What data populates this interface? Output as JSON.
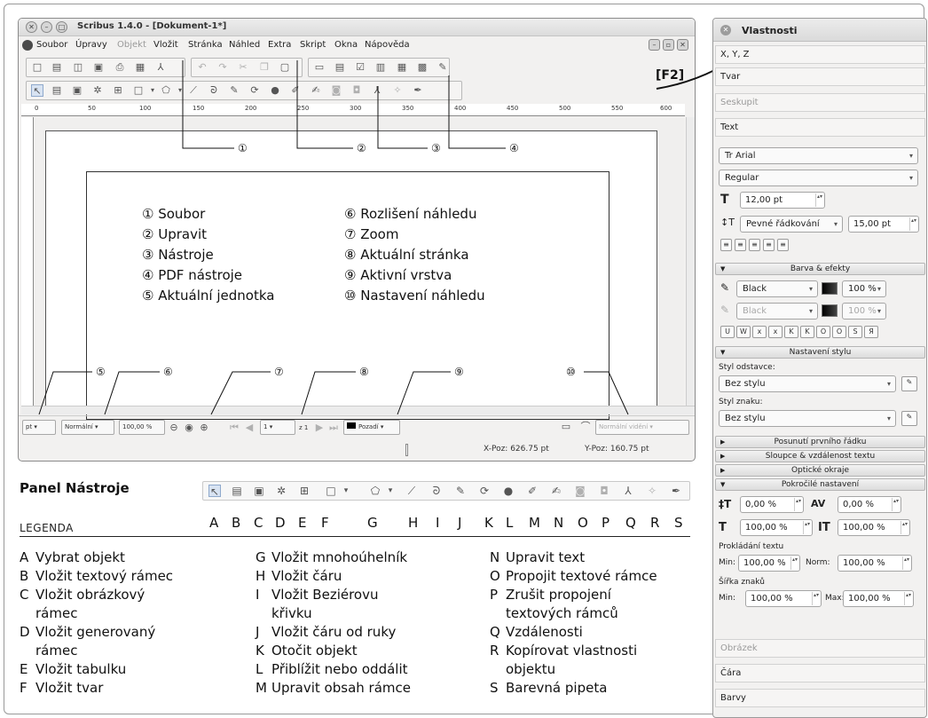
{
  "window": {
    "title": "Scribus 1.4.0 - [Dokument-1*]",
    "menu": [
      "Soubor",
      "Úpravy",
      "Objekt",
      "Vložit",
      "Stránka",
      "Náhled",
      "Extra",
      "Skript",
      "Okna",
      "Nápověda"
    ],
    "shortcut_hint": "[F2]"
  },
  "callouts": [
    "①",
    "②",
    "③",
    "④",
    "⑤",
    "⑥",
    "⑦",
    "⑧",
    "⑨",
    "⑩"
  ],
  "legend_left": [
    "① Soubor",
    "② Upravit",
    "③ Nástroje",
    "④ PDF nástroje",
    "⑤ Aktuální jednotka"
  ],
  "legend_right": [
    "⑥ Rozlišení náhledu",
    "⑦ Zoom",
    "⑧ Aktuální stránka",
    "⑨ Aktivní vrstva",
    "⑩ Nastavení náhledu"
  ],
  "statusbar": {
    "unit": "pt",
    "preview_quality": "Normální",
    "zoom": "100,00 %",
    "page": "1",
    "page_total": "z 1",
    "layer": "Pozadí",
    "preview_mode": "Normální vidění",
    "xpos": "X-Poz: 626.75 pt",
    "ypos": "Y-Poz: 160.75 pt"
  },
  "ruler": [
    "0",
    "50",
    "100",
    "150",
    "200",
    "250",
    "300",
    "350",
    "400",
    "450",
    "500",
    "550",
    "600"
  ],
  "tools_panel": {
    "title": "Panel Nástroje",
    "legend_heading": "LEGENDA",
    "letters": [
      "A",
      "B",
      "C",
      "D",
      "E",
      "F",
      "G",
      "H",
      "I",
      "J",
      "K",
      "L",
      "M",
      "N",
      "O",
      "P",
      "Q",
      "R",
      "S"
    ],
    "col1": [
      {
        "k": "A",
        "t": "Vybrat objekt"
      },
      {
        "k": "B",
        "t": "Vložit textový rámec"
      },
      {
        "k": "C",
        "t": "Vložit obrázkový"
      },
      {
        "k": "",
        "t": "rámec"
      },
      {
        "k": "D",
        "t": "Vložit generovaný"
      },
      {
        "k": "",
        "t": "rámec"
      },
      {
        "k": "E",
        "t": "Vložit tabulku"
      },
      {
        "k": "F",
        "t": "Vložit tvar"
      }
    ],
    "col2": [
      {
        "k": "G",
        "t": "Vložit mnohoúhelník"
      },
      {
        "k": "H",
        "t": "Vložit čáru"
      },
      {
        "k": "I",
        "t": "Vložit Beziérovu"
      },
      {
        "k": "",
        "t": "křivku"
      },
      {
        "k": "J",
        "t": "Vložit čáru od ruky"
      },
      {
        "k": "K",
        "t": "Otočit objekt"
      },
      {
        "k": "L",
        "t": "Přiblížit nebo oddálit"
      },
      {
        "k": "M",
        "t": "Upravit obsah rámce"
      }
    ],
    "col3": [
      {
        "k": "N",
        "t": "Upravit text"
      },
      {
        "k": "O",
        "t": "Propojit textové rámce"
      },
      {
        "k": "P",
        "t": "Zrušit propojení"
      },
      {
        "k": "",
        "t": "textových rámců"
      },
      {
        "k": "Q",
        "t": "Vzdálenosti"
      },
      {
        "k": "R",
        "t": "Kopírovat vlastnosti"
      },
      {
        "k": "",
        "t": "objektu"
      },
      {
        "k": "S",
        "t": "Barevná pipeta"
      }
    ]
  },
  "props": {
    "title": "Vlastnosti",
    "sections": {
      "xyz": "X, Y, Z",
      "tvar": "Tvar",
      "seskupit": "Seskupit",
      "text": "Text",
      "obrazek": "Obrázek",
      "cara": "Čára",
      "barvy": "Barvy"
    },
    "font": "Arial",
    "font_style": "Regular",
    "font_size": "12,00 pt",
    "line_spacing_mode": "Pevné řádkování",
    "line_spacing": "15,00 pt",
    "color_group": "Barva & efekty",
    "stroke_color": "Black",
    "stroke_shade": "100 %",
    "fill_color": "Black",
    "fill_shade": "100 %",
    "effects": [
      "U",
      "W",
      "x",
      "x",
      "K",
      "K",
      "O",
      "O",
      "S",
      "Я"
    ],
    "style_group": "Nastavení stylu",
    "par_style_label": "Styl odstavce:",
    "par_style": "Bez stylu",
    "char_style_label": "Styl znaku:",
    "char_style": "Bez stylu",
    "collapsed": [
      "Posunutí prvního řádku",
      "Sloupce & vzdálenost textu",
      "Optické okraje"
    ],
    "advanced_group": "Pokročilé nastavení",
    "baseline": "0,00 %",
    "tracking": "0,00 %",
    "scale_h": "100,00 %",
    "scale_v": "100,00 %",
    "proklad_label": "Prokládání textu",
    "min_label": "Min:",
    "norm_label": "Norm:",
    "max_label": "Max:",
    "proklad_min": "100,00 %",
    "proklad_norm": "100,00 %",
    "sirka_label": "Šířka znaků",
    "sirka_min": "100,00 %",
    "sirka_max": "100,00 %"
  }
}
